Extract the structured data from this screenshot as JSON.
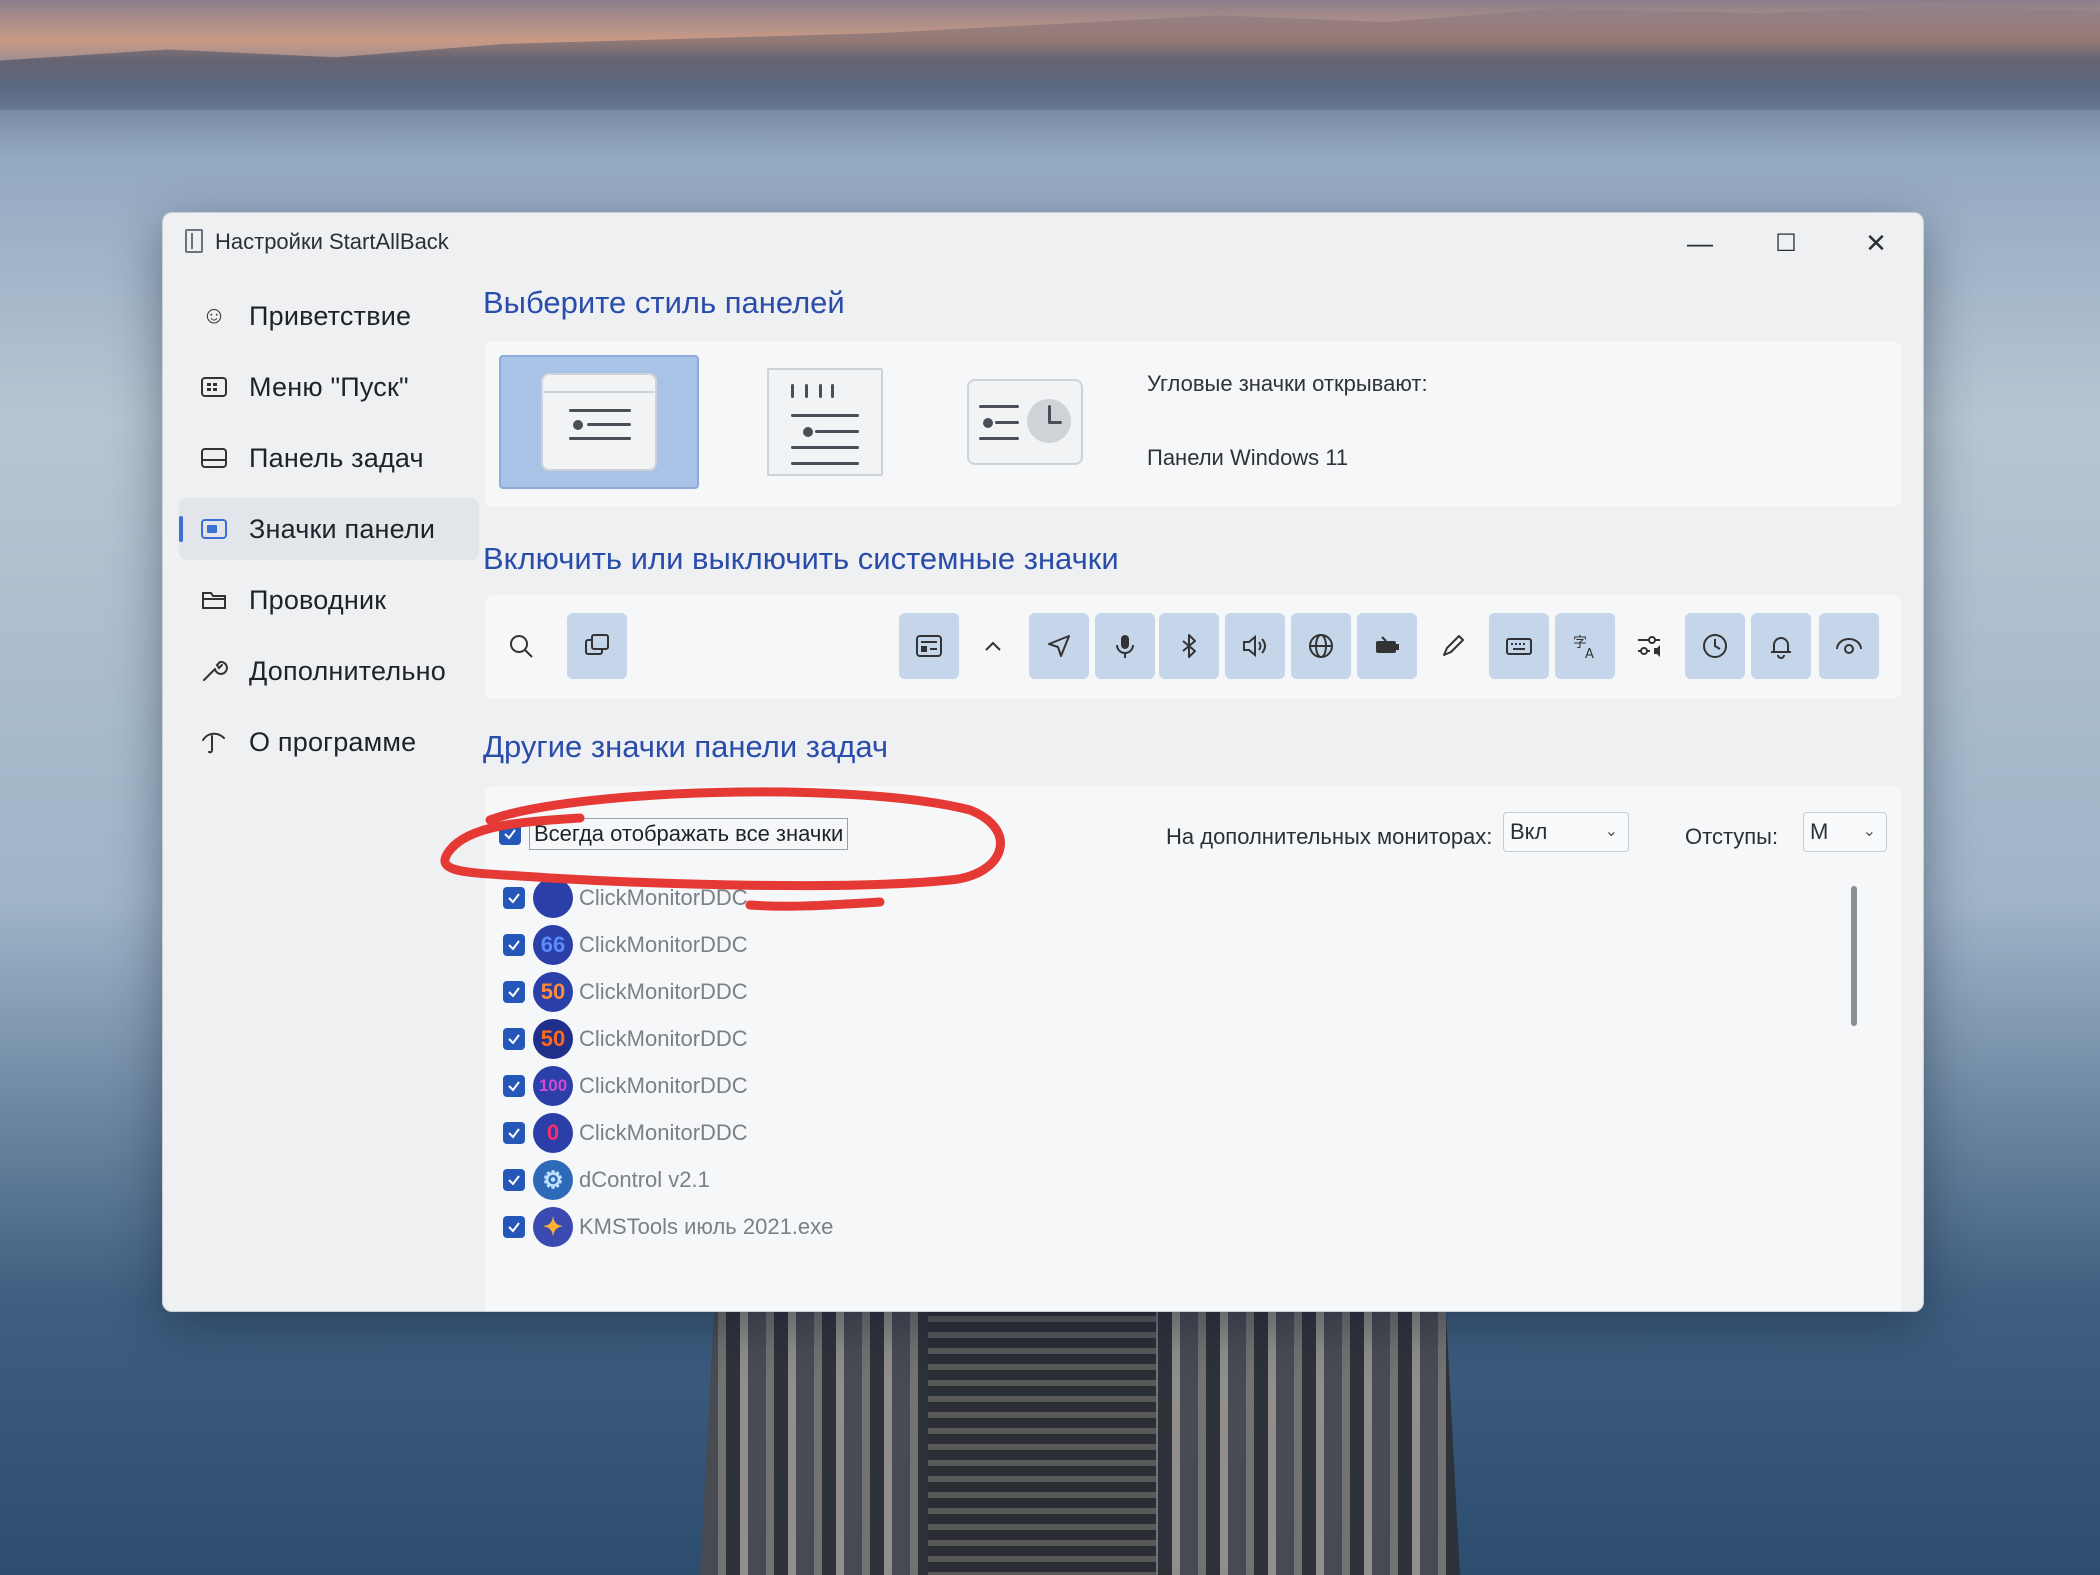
{
  "window": {
    "title": "Настройки StartAllBack",
    "controls": {
      "minimize": "—",
      "maximize": "☐",
      "close": "✕"
    }
  },
  "nav": {
    "items": [
      {
        "label": "Приветствие",
        "icon": "smile-icon"
      },
      {
        "label": "Меню \"Пуск\"",
        "icon": "start-menu-icon"
      },
      {
        "label": "Панель задач",
        "icon": "taskbar-icon"
      },
      {
        "label": "Значки панели",
        "icon": "tray-icons-icon",
        "active": true
      },
      {
        "label": "Проводник",
        "icon": "explorer-icon"
      },
      {
        "label": "Дополнительно",
        "icon": "wrench-icon"
      },
      {
        "label": "О программе",
        "icon": "about-icon"
      }
    ]
  },
  "style_section": {
    "title": "Выберите стиль панелей",
    "corner_label": "Угловые значки открывают:",
    "corner_value": "Панели Windows 11"
  },
  "system_section": {
    "title": "Включить или выключить системные значки",
    "icons": [
      {
        "name": "search-icon",
        "on": false
      },
      {
        "name": "task-view-icon",
        "on": true
      },
      {
        "name": "widgets-icon",
        "on": true
      },
      {
        "name": "overflow-chevron-icon",
        "on": false
      },
      {
        "name": "location-icon",
        "on": true
      },
      {
        "name": "microphone-icon",
        "on": true
      },
      {
        "name": "bluetooth-icon",
        "on": true
      },
      {
        "name": "volume-icon",
        "on": true
      },
      {
        "name": "network-icon",
        "on": true
      },
      {
        "name": "battery-icon",
        "on": true
      },
      {
        "name": "pen-icon",
        "on": false
      },
      {
        "name": "keyboard-icon",
        "on": true
      },
      {
        "name": "language-icon",
        "on": true
      },
      {
        "name": "quick-settings-icon",
        "on": false
      },
      {
        "name": "clock-icon",
        "on": true
      },
      {
        "name": "bell-icon",
        "on": true
      },
      {
        "name": "eye-icon",
        "on": true
      }
    ]
  },
  "other_section": {
    "title": "Другие значки панели задач",
    "always_show_label": "Всегда отображать все значки",
    "always_show_checked": true,
    "secondary_monitors_label": "На дополнительных мониторах:",
    "secondary_monitors_value": "Вкл",
    "indent_label": "Отступы:",
    "indent_value": "M",
    "apps": [
      {
        "name": "ClickMonitorDDC",
        "badge": "",
        "checked": true
      },
      {
        "name": "ClickMonitorDDC",
        "badge": "66",
        "checked": true
      },
      {
        "name": "ClickMonitorDDC",
        "badge": "50",
        "checked": true
      },
      {
        "name": "ClickMonitorDDC",
        "badge": "50",
        "checked": true
      },
      {
        "name": "ClickMonitorDDC",
        "badge": "100",
        "checked": true
      },
      {
        "name": "ClickMonitorDDC",
        "badge": "0",
        "checked": true
      },
      {
        "name": "dControl v2.1",
        "badge": "",
        "checked": true
      },
      {
        "name": "KMSTools июль 2021.exe",
        "badge": "",
        "checked": true
      }
    ]
  },
  "colors": {
    "accent": "#2557b8",
    "heading": "#2a4cab",
    "selected_style": "#a9c3e6",
    "annotation": "#e53935"
  }
}
